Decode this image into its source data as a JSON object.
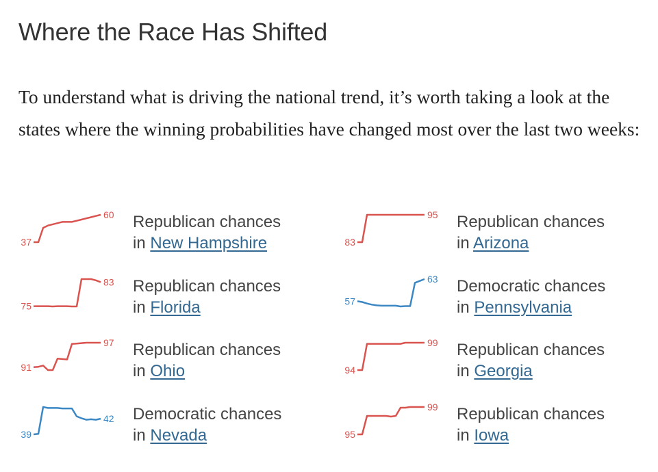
{
  "title": "Where the Race Has Shifted",
  "intro": "To understand what is driving the national trend, it’s worth taking a look at the states where the winning probabilities have changed most over the last two weeks:",
  "colors": {
    "republican": "#d9534f",
    "democratic": "#3b87c4",
    "link": "#326891"
  },
  "chart_data": [
    {
      "type": "line",
      "state": "New Hampshire",
      "label_prefix": "Republican chances",
      "in_word": "in",
      "party": "republican",
      "start_label": "37",
      "end_label": "60",
      "values": [
        37,
        37,
        49,
        51,
        52,
        53,
        54,
        54,
        54,
        55,
        56,
        57,
        58,
        59,
        60
      ]
    },
    {
      "type": "line",
      "state": "Arizona",
      "label_prefix": "Republican chances",
      "in_word": "in",
      "party": "republican",
      "start_label": "83",
      "end_label": "95",
      "values": [
        83,
        83,
        95,
        95,
        95,
        95,
        95,
        95,
        95,
        95,
        95,
        95,
        95,
        95,
        95
      ]
    },
    {
      "type": "line",
      "state": "Florida",
      "label_prefix": "Republican chances",
      "in_word": "in",
      "party": "republican",
      "start_label": "75",
      "end_label": "83",
      "values": [
        75,
        75,
        75,
        75,
        74.9,
        75,
        75,
        75,
        74.9,
        74.9,
        84,
        84,
        84,
        83.6,
        83
      ]
    },
    {
      "type": "line",
      "state": "Pennsylvania",
      "label_prefix": "Democratic chances",
      "in_word": "in",
      "party": "democratic",
      "start_label": "57",
      "end_label": "63",
      "values": [
        57,
        56.8,
        56.4,
        56.1,
        55.9,
        55.8,
        55.8,
        55.8,
        55.8,
        55.6,
        55.7,
        55.7,
        62,
        62.5,
        63
      ]
    },
    {
      "type": "line",
      "state": "Ohio",
      "label_prefix": "Republican chances",
      "in_word": "in",
      "party": "republican",
      "start_label": "91",
      "end_label": "97",
      "values": [
        91,
        91.1,
        91.4,
        90.3,
        90.3,
        93.1,
        93,
        92.9,
        96.7,
        96.8,
        96.9,
        97,
        97,
        97,
        97
      ]
    },
    {
      "type": "line",
      "state": "Georgia",
      "label_prefix": "Republican chances",
      "in_word": "in",
      "party": "republican",
      "start_label": "94",
      "end_label": "99",
      "values": [
        94,
        94,
        98.8,
        98.8,
        98.8,
        98.8,
        98.8,
        98.8,
        98.8,
        98.8,
        99,
        99,
        99,
        99,
        99
      ]
    },
    {
      "type": "line",
      "state": "Nevada",
      "label_prefix": "Democratic chances",
      "in_word": "in",
      "party": "democratic",
      "start_label": "39",
      "end_label": "42",
      "values": [
        39,
        39.1,
        44.6,
        44.4,
        44.4,
        44.4,
        44.3,
        44.3,
        44.3,
        42.7,
        42.3,
        42,
        42.1,
        42,
        42.2
      ]
    },
    {
      "type": "line",
      "state": "Iowa",
      "label_prefix": "Republican chances",
      "in_word": "in",
      "party": "republican",
      "start_label": "95",
      "end_label": "99",
      "values": [
        95,
        95,
        97.7,
        97.7,
        97.7,
        97.7,
        97.7,
        97.6,
        97.7,
        98.9,
        98.9,
        99,
        99,
        99,
        99
      ]
    }
  ]
}
